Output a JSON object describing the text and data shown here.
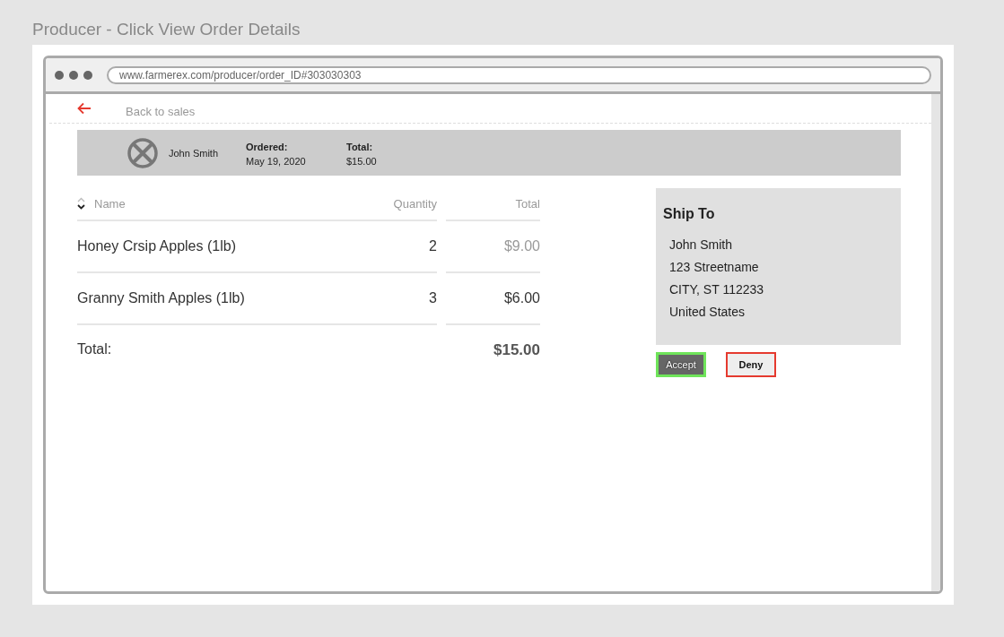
{
  "frame_title": "Producer - Click View Order Details",
  "browser": {
    "url": "www.farmerex.com/producer/order_ID#303030303"
  },
  "back_link": "Back to sales",
  "order_summary": {
    "customer": "John Smith",
    "ordered_label": "Ordered:",
    "ordered_date": "May 19, 2020",
    "total_label": "Total:",
    "total_value": "$15.00"
  },
  "table": {
    "columns": [
      "Name",
      "Quantity",
      "Total"
    ],
    "rows": [
      {
        "name": "Honey Crsip Apples (1lb)",
        "quantity": "2",
        "total": "$9.00",
        "dimmed": true
      },
      {
        "name": "Granny Smith Apples (1lb)",
        "quantity": "3",
        "total": "$6.00",
        "dimmed": false
      }
    ],
    "footer": {
      "label": "Total:",
      "value": "$15.00"
    }
  },
  "ship_to": {
    "title": "Ship To",
    "lines": [
      "John Smith",
      "123 Streetname",
      "CITY, ST 112233",
      "United States"
    ]
  },
  "buttons": [
    {
      "label": "Accept",
      "kind": "accept"
    },
    {
      "label": "Deny",
      "kind": "deny"
    }
  ]
}
